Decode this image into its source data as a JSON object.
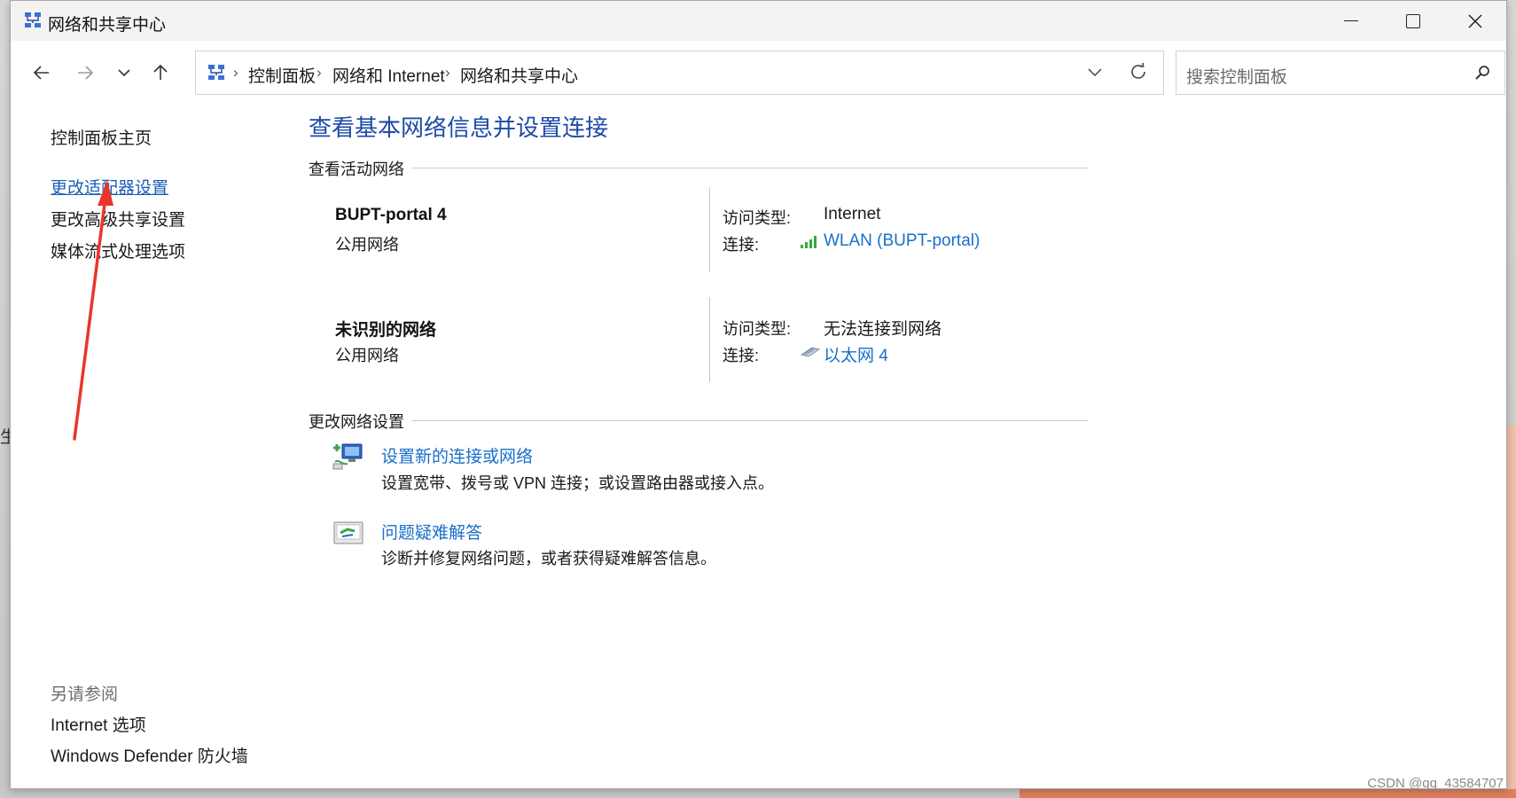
{
  "window": {
    "title": "网络和共享中心"
  },
  "address": {
    "crumbs": [
      "控制面板",
      "网络和 Internet",
      "网络和共享中心"
    ],
    "separator": "›"
  },
  "search": {
    "placeholder": "搜索控制面板"
  },
  "sidebar": {
    "home": "控制面板主页",
    "links": [
      "更改适配器设置",
      "更改高级共享设置",
      "媒体流式处理选项"
    ],
    "see_also_title": "另请参阅",
    "see_also": [
      "Internet 选项",
      "Windows Defender 防火墙"
    ]
  },
  "main": {
    "heading": "查看基本网络信息并设置连接",
    "active_section": "查看活动网络",
    "networks": [
      {
        "name": "BUPT-portal 4",
        "category": "公用网络",
        "access_label": "访问类型:",
        "access_value": "Internet",
        "conn_label": "连接:",
        "conn_value": "WLAN (BUPT-portal)"
      },
      {
        "name": "未识别的网络",
        "category": "公用网络",
        "access_label": "访问类型:",
        "access_value": "无法连接到网络",
        "conn_label": "连接:",
        "conn_value": "以太网 4"
      }
    ],
    "change_section": "更改网络设置",
    "tasks": [
      {
        "title": "设置新的连接或网络",
        "desc": "设置宽带、拨号或 VPN 连接；或设置路由器或接入点。"
      },
      {
        "title": "问题疑难解答",
        "desc": "诊断并修复网络问题，或者获得疑难解答信息。"
      }
    ]
  },
  "watermark": "CSDN @qq_43584707",
  "background_glyph": "生",
  "colors": {
    "link": "#1a6fc9",
    "heading": "#1e4aa8",
    "annotation_arrow": "#e8362b"
  }
}
